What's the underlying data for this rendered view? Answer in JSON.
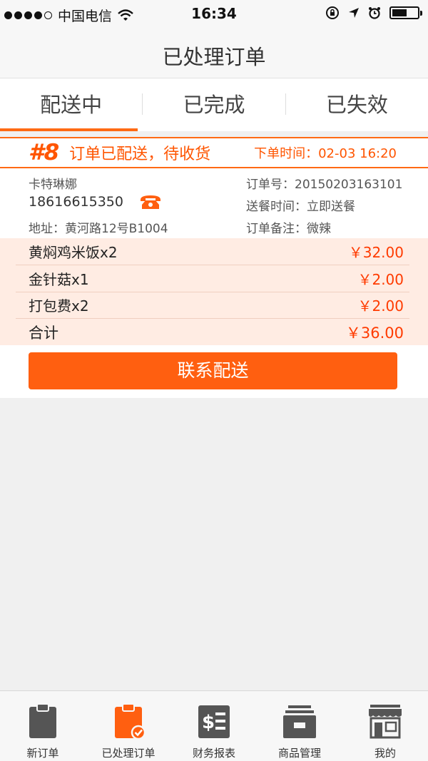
{
  "status_bar": {
    "carrier": "中国电信",
    "time": "16:34"
  },
  "nav": {
    "title": "已处理订单"
  },
  "tabs": [
    {
      "label": "配送中",
      "active": true
    },
    {
      "label": "已完成",
      "active": false
    },
    {
      "label": "已失效",
      "active": false
    }
  ],
  "order": {
    "number": "#8",
    "status": "订单已配送，待收货",
    "order_time": "下单时间：02-03 16:20",
    "customer_name": "卡特琳娜",
    "phone": "18616615350",
    "address": "地址：黄河路12号B1004",
    "order_no": "订单号：20150203163101",
    "delivery_time": "送餐时间：立即送餐",
    "note": "订单备注：微辣",
    "items": [
      {
        "name": "黄焖鸡米饭x2",
        "price": "￥32.00"
      },
      {
        "name": "金针菇x1",
        "price": "￥2.00"
      },
      {
        "name": "打包费x2",
        "price": "￥2.00"
      },
      {
        "name": "合计",
        "price": "￥36.00"
      }
    ],
    "action_label": "联系配送"
  },
  "tabbar": [
    {
      "label": "新订单",
      "icon": "clipboard-icon",
      "active": false
    },
    {
      "label": "已处理订单",
      "icon": "clipboard-check-icon",
      "active": true
    },
    {
      "label": "财务报表",
      "icon": "finance-report-icon",
      "active": false
    },
    {
      "label": "商品管理",
      "icon": "product-box-icon",
      "active": false
    },
    {
      "label": "我的",
      "icon": "shop-icon",
      "active": false
    }
  ],
  "colors": {
    "accent": "#ff5f10",
    "price": "#ff3b00",
    "item_bg": "#ffece3"
  }
}
